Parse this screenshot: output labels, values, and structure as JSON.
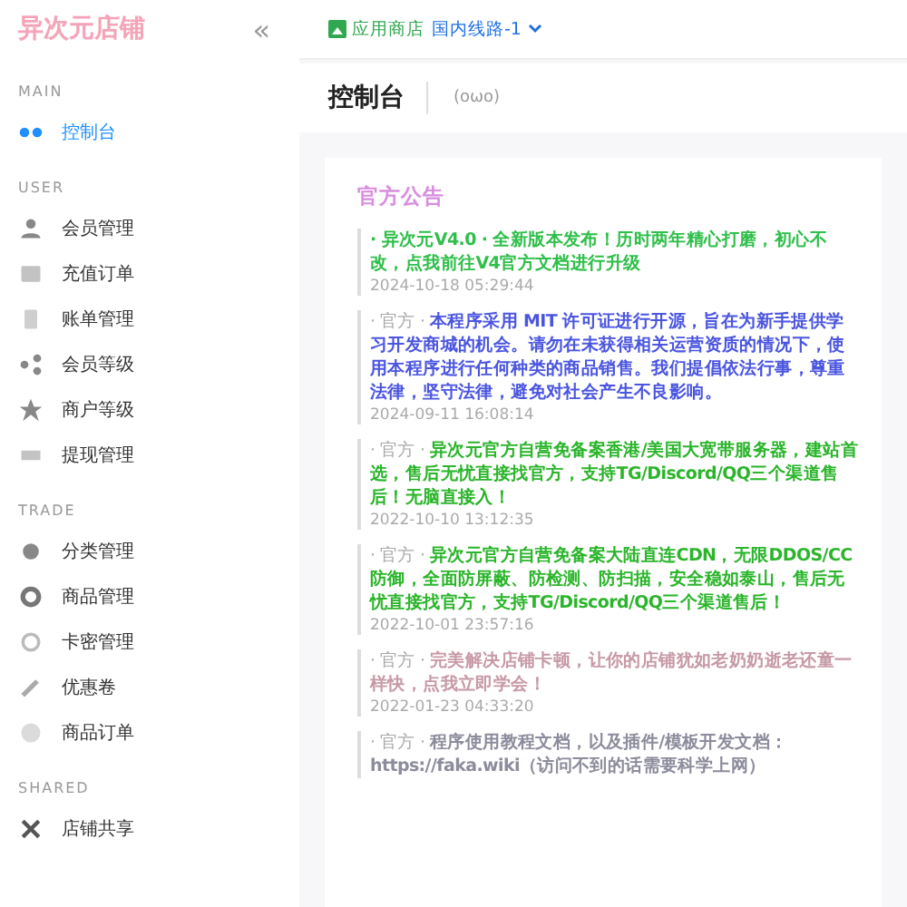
{
  "sidebar": {
    "logo": "异次元店铺",
    "collapse": "«",
    "sections": [
      {
        "title": "MAIN",
        "items": [
          {
            "label": "控制台",
            "selected": true
          }
        ]
      },
      {
        "title": "USER",
        "items": [
          {
            "label": "会员管理",
            "selected": false
          },
          {
            "label": "充值订单",
            "selected": false
          },
          {
            "label": "账单管理",
            "selected": false
          },
          {
            "label": "会员等级",
            "selected": false
          },
          {
            "label": "商户等级",
            "selected": false
          },
          {
            "label": "提现管理",
            "selected": false
          }
        ]
      },
      {
        "title": "TRADE",
        "items": [
          {
            "label": "分类管理",
            "selected": false
          },
          {
            "label": "商品管理",
            "selected": false
          },
          {
            "label": "卡密管理",
            "selected": false
          },
          {
            "label": "优惠卷",
            "selected": false
          },
          {
            "label": "商品订单",
            "selected": false
          }
        ]
      },
      {
        "title": "SHARED",
        "items": [
          {
            "label": "店铺共享",
            "selected": false
          }
        ]
      }
    ]
  },
  "topbar": {
    "app_store": "应用商店",
    "route": "国内线路-1"
  },
  "page": {
    "title": "控制台",
    "emoticon": "(oωo)"
  },
  "announcements": {
    "title": "官方公告",
    "items": [
      {
        "tag": "· 异次元V4.0 ·",
        "tag_bold": true,
        "body": "全新版本发布！历时两年精心打磨，初心不改，点我前往V4官方文档进行升级",
        "date": "2024-10-18 05:29:44",
        "color": "#2fbf4a"
      },
      {
        "tag": "· 官方 ·",
        "tag_bold": false,
        "body": "本程序采用 MIT 许可证进行开源，旨在为新手提供学习开发商城的机会。请勿在未获得相关运营资质的情况下，使用本程序进行任何种类的商品销售。我们提倡依法行事，尊重法律，坚守法律，避免对社会产生不良影响。",
        "date": "2024-09-11 16:08:14",
        "color": "#4b56e0"
      },
      {
        "tag": "· 官方 ·",
        "tag_bold": false,
        "body": "异次元官方自营免备案香港/美国大宽带服务器，建站首选，售后无忧直接找官方，支持TG/Discord/QQ三个渠道售后！无脑直接入！",
        "date": "2022-10-10 13:12:35",
        "color": "#2bb52b"
      },
      {
        "tag": "· 官方 ·",
        "tag_bold": false,
        "body": "异次元官方自营免备案大陆直连CDN，无限DDOS/CC防御，全面防屏蔽、防检测、防扫描，安全稳如泰山，售后无忧直接找官方，支持TG/Discord/QQ三个渠道售后！",
        "date": "2022-10-01 23:57:16",
        "color": "#2bb52b"
      },
      {
        "tag": "· 官方 ·",
        "tag_bold": false,
        "body": "完美解决店铺卡顿，让你的店铺犹如老奶奶逝老还童一样快，点我立即学会！",
        "date": "2022-01-23 04:33:20",
        "color": "#c79aa6"
      },
      {
        "tag": "· 官方 ·",
        "tag_bold": false,
        "body": "程序使用教程文档，以及插件/模板开发文档：https://faka.wiki（访问不到的话需要科学上网）",
        "color": "#8c8c9c"
      }
    ]
  }
}
